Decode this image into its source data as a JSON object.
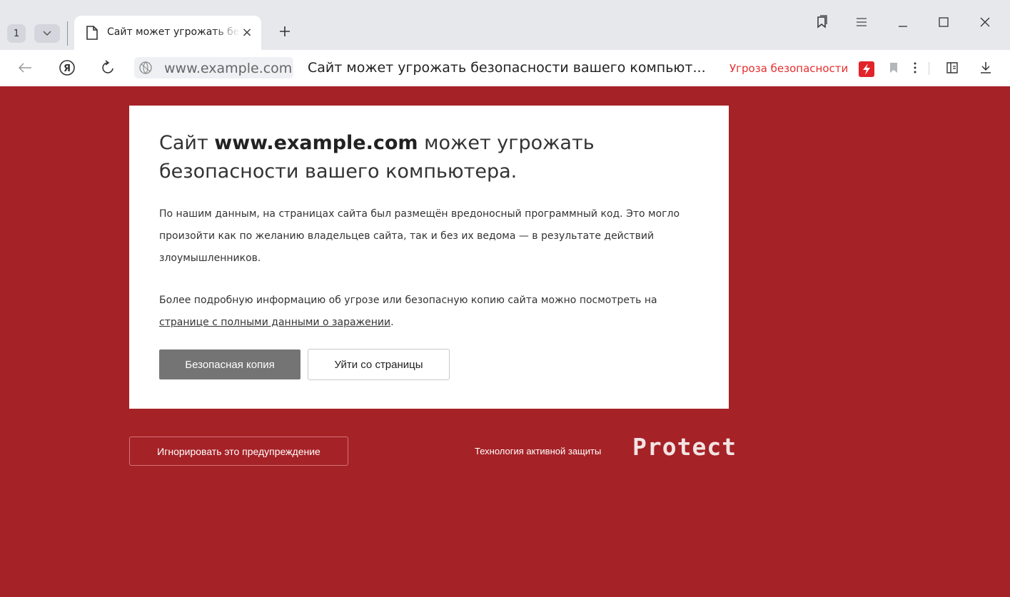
{
  "browser": {
    "tab_count": "1",
    "tab_title": "Сайт может угрожать безопасности вашего компьютера",
    "tab_close_glyph": "×",
    "new_tab_glyph": "+"
  },
  "address_bar": {
    "domain": "www.example.com",
    "page_title": "Сайт может угрожать безопасности вашего компьют...",
    "threat_label": "Угроза безопасности",
    "threat_color": "#e52e2e"
  },
  "warning": {
    "headline_prefix": "Сайт",
    "headline_domain": "www.example.com",
    "headline_suffix": "может угрожать безопасности вашего компьютера.",
    "paragraph1": "По нашим данным, на страницах сайта был размещён вредоносный программный код. Это могло произойти как по желанию владельцев сайта, так и без их ведома — в результате действий злоумышленников.",
    "paragraph2_before": "Более подробную информацию об угрозе или безопасную копию сайта можно посмотреть на",
    "paragraph2_link": "странице с полными данными о заражении",
    "paragraph2_after": ".",
    "safe_copy_button": "Безопасная копия",
    "leave_button": "Уйти со страницы"
  },
  "footer": {
    "ignore_button": "Игнорировать это предупреждение",
    "protect_caption": "Технология активной защиты",
    "protect_logo": "Protect"
  },
  "colors": {
    "page_background": "#a52227",
    "safe_button": "#747474",
    "badge": "#e2232a"
  },
  "icons": [
    "chevron-down-icon",
    "document-icon",
    "close-icon",
    "plus-icon",
    "collections-icon",
    "menu-icon",
    "minimize-icon",
    "maximize-icon",
    "close-window-icon",
    "back-arrow-icon",
    "yandex-icon",
    "reload-icon",
    "globe-icon",
    "protect-lightning-icon",
    "bookmark-icon",
    "more-vertical-icon",
    "side-panel-icon",
    "download-icon"
  ]
}
